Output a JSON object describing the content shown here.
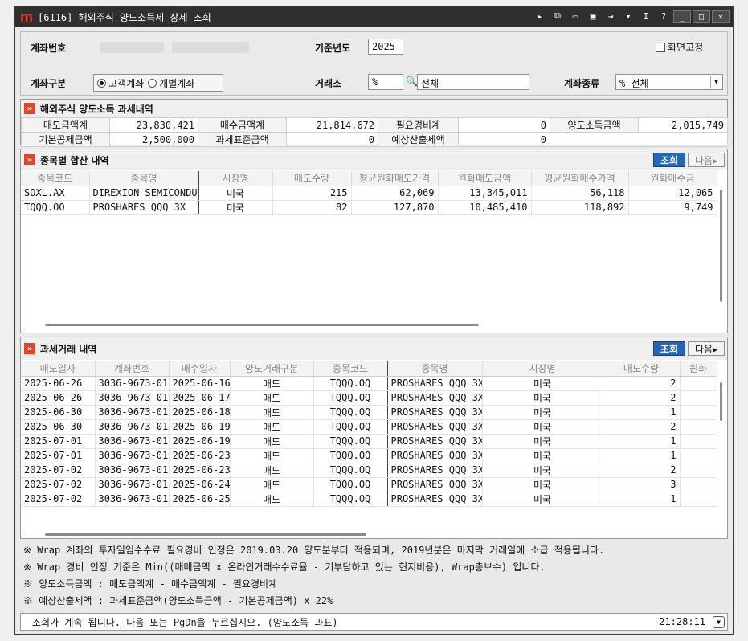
{
  "window": {
    "logo": "m",
    "title": "[6116] 해외주식 양도소득세 상세 조회",
    "icons": [
      "play-icon",
      "window-icon",
      "square-icon",
      "print-icon",
      "export-icon",
      "pin-icon",
      "text-icon",
      "help-icon"
    ],
    "icon_glyphs": [
      "▸",
      "⧉",
      "▭",
      "▣",
      "⇥",
      "▾",
      "I",
      "?"
    ],
    "buttons": [
      "_",
      "□",
      "✕"
    ]
  },
  "form": {
    "account_label": "계좌번호",
    "base_year_label": "기준년도",
    "base_year": "2025",
    "screen_fix_label": "화면고정",
    "account_type_label": "계좌구분",
    "radio_customer": "고객계좌",
    "radio_individual": "개별계좌",
    "exchange_label": "거래소",
    "exchange_code": "%",
    "exchange_name": "전체",
    "account_kind_label": "계좌종류",
    "account_kind_value": "% 전체"
  },
  "summary": {
    "title": "해외주식 양도소득 과세내역",
    "rows": [
      [
        [
          "매도금액계",
          "23,830,421"
        ],
        [
          "매수금액계",
          "21,814,672"
        ],
        [
          "필요경비계",
          "0"
        ],
        [
          "양도소득금액",
          "2,015,749"
        ]
      ],
      [
        [
          "기본공제금액",
          "2,500,000"
        ],
        [
          "과세표준금액",
          "0"
        ],
        [
          "예상산출세액",
          "0"
        ],
        [
          "",
          ""
        ]
      ]
    ]
  },
  "by_stock": {
    "title": "종목별 합산 내역",
    "query_label": "조회",
    "next_label": "다음▸",
    "columns": [
      "종목코드",
      "종목명",
      "시장명",
      "매도수량",
      "평균원화매도가격",
      "원화매도금액",
      "평균원화매수가격",
      "원화매수금"
    ],
    "rows": [
      [
        "SOXL.AX",
        "DIREXION SEMICONDUC",
        "미국",
        "215",
        "62,069",
        "13,345,011",
        "56,118",
        "12,065"
      ],
      [
        "TQQQ.OQ",
        "PROSHARES QQQ 3X",
        "미국",
        "82",
        "127,870",
        "10,485,410",
        "118,892",
        "9,749"
      ]
    ]
  },
  "trades": {
    "title": "과세거래 내역",
    "query_label": "조회",
    "next_label": "다음▸",
    "columns": [
      "매도일자",
      "계좌번호",
      "매수일자",
      "양도거래구분",
      "종목코드",
      "종목명",
      "시장명",
      "매도수량",
      "원화"
    ],
    "rows": [
      [
        "2025-06-26",
        "3036-9673-01",
        "2025-06-16",
        "매도",
        "TQQQ.OQ",
        "PROSHARES QQQ 3X",
        "미국",
        "2",
        ""
      ],
      [
        "2025-06-26",
        "3036-9673-01",
        "2025-06-17",
        "매도",
        "TQQQ.OQ",
        "PROSHARES QQQ 3X",
        "미국",
        "2",
        ""
      ],
      [
        "2025-06-30",
        "3036-9673-01",
        "2025-06-18",
        "매도",
        "TQQQ.OQ",
        "PROSHARES QQQ 3X",
        "미국",
        "1",
        ""
      ],
      [
        "2025-06-30",
        "3036-9673-01",
        "2025-06-19",
        "매도",
        "TQQQ.OQ",
        "PROSHARES QQQ 3X",
        "미국",
        "2",
        ""
      ],
      [
        "2025-07-01",
        "3036-9673-01",
        "2025-06-19",
        "매도",
        "TQQQ.OQ",
        "PROSHARES QQQ 3X",
        "미국",
        "1",
        ""
      ],
      [
        "2025-07-01",
        "3036-9673-01",
        "2025-06-23",
        "매도",
        "TQQQ.OQ",
        "PROSHARES QQQ 3X",
        "미국",
        "1",
        ""
      ],
      [
        "2025-07-02",
        "3036-9673-01",
        "2025-06-23",
        "매도",
        "TQQQ.OQ",
        "PROSHARES QQQ 3X",
        "미국",
        "2",
        ""
      ],
      [
        "2025-07-02",
        "3036-9673-01",
        "2025-06-24",
        "매도",
        "TQQQ.OQ",
        "PROSHARES QQQ 3X",
        "미국",
        "3",
        ""
      ],
      [
        "2025-07-02",
        "3036-9673-01",
        "2025-06-25",
        "매도",
        "TQQQ.OQ",
        "PROSHARES QQQ 3X",
        "미국",
        "1",
        ""
      ]
    ]
  },
  "notes": [
    "※ Wrap 계좌의 투자일임수수료 필요경비 인정은 2019.03.20 양도분부터 적용되며, 2019년분은 마지막 거래일에 소급 적용됩니다.",
    "※ Wrap 경비 인정 기준은 Min((매매금액 x 온라인거래수수료율 - 기부담하고 있는 현지비용), Wrap총보수) 입니다.",
    "※ 양도소득금액 : 매도금액계 - 매수금액계 - 필요경비계",
    "※ 예상산출세액 : 과세표준금액(양도소득금액 - 기본공제금액) x 22%"
  ],
  "status": {
    "message": "조회가 계속 됩니다. 다음 또는 PgDn을 누르십시오. (양도소득 과표)",
    "time": "21:28:11"
  }
}
